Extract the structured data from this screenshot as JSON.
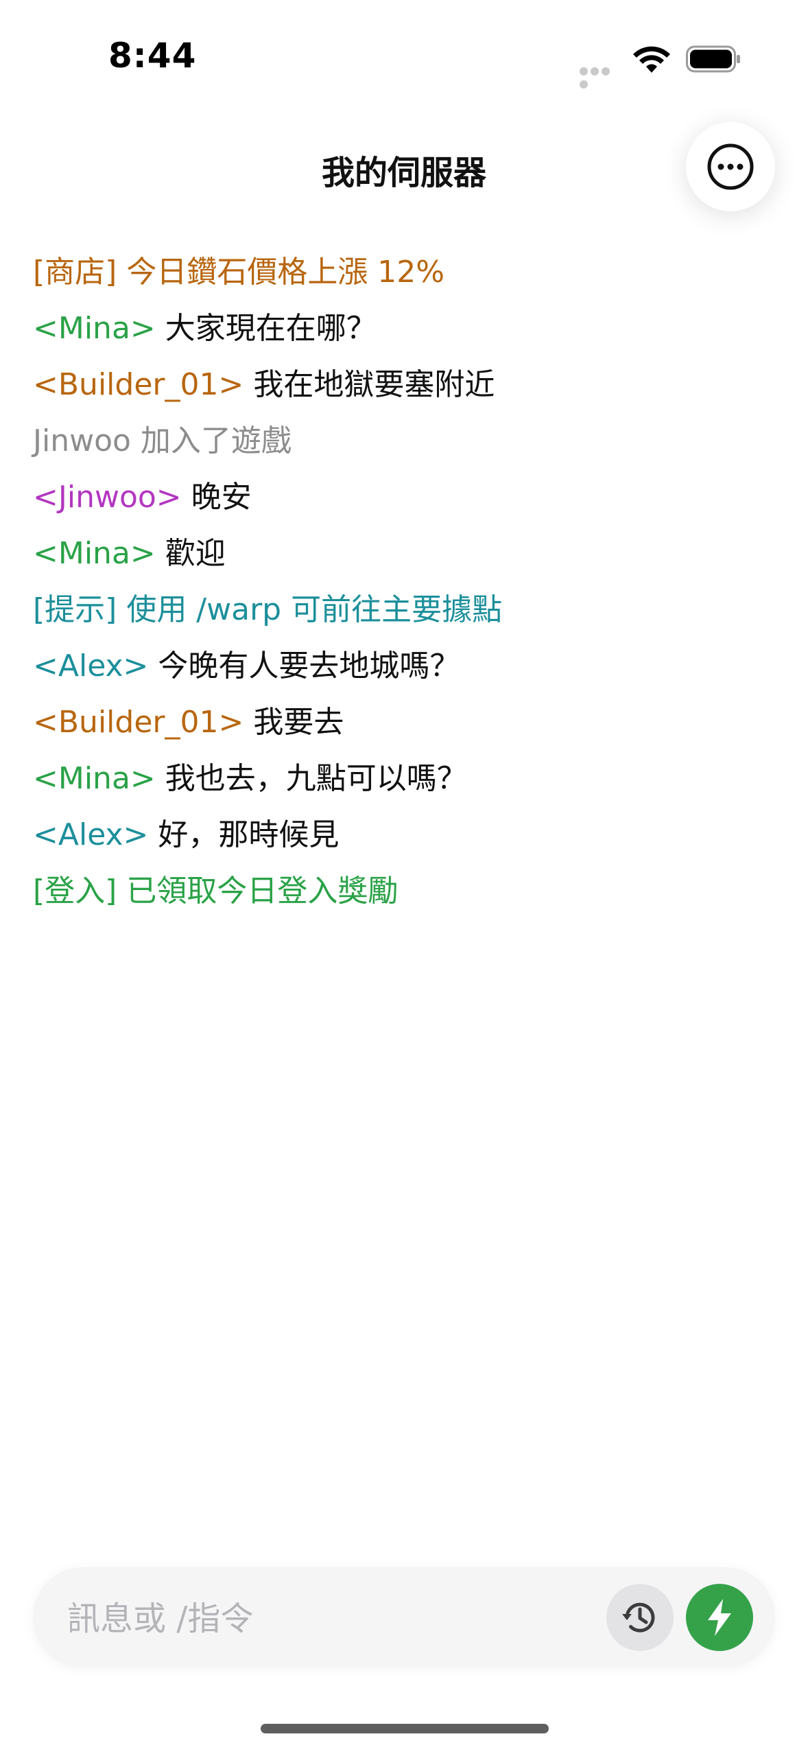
{
  "status_bar": {
    "time": "8:44"
  },
  "header": {
    "title": "我的伺服器",
    "more_icon": "ellipsis-circle-icon"
  },
  "colors": {
    "shop": "#b8660f",
    "green_name": "#2aa247",
    "orange_name": "#b8660f",
    "system_gray": "#8c8c8c",
    "magenta_name": "#b236c0",
    "teal": "#1c8f9b",
    "login_green": "#2aa247",
    "text": "#111111",
    "send_button": "#35a24a"
  },
  "chat": {
    "lines": [
      {
        "prefix": "[商店] 今日鑽石價格上漲 12%",
        "text": "",
        "color": "#b8660f"
      },
      {
        "prefix": "<Mina>",
        "text": " 大家現在在哪？",
        "color": "#2aa247"
      },
      {
        "prefix": "<Builder_01>",
        "text": " 我在地獄要塞附近",
        "color": "#b8660f"
      },
      {
        "prefix": "Jinwoo 加入了遊戲",
        "text": "",
        "color": "#8c8c8c"
      },
      {
        "prefix": "<Jinwoo>",
        "text": " 晚安",
        "color": "#b236c0"
      },
      {
        "prefix": "<Mina>",
        "text": " 歡迎",
        "color": "#2aa247"
      },
      {
        "prefix": "[提示] 使用 /warp 可前往主要據點",
        "text": "",
        "color": "#1c8f9b"
      },
      {
        "prefix": "<Alex>",
        "text": " 今晚有人要去地城嗎？",
        "color": "#1c8f9b"
      },
      {
        "prefix": "<Builder_01>",
        "text": " 我要去",
        "color": "#b8660f"
      },
      {
        "prefix": "<Mina>",
        "text": " 我也去，九點可以嗎？",
        "color": "#2aa247"
      },
      {
        "prefix": "<Alex>",
        "text": " 好，那時候見",
        "color": "#1c8f9b"
      },
      {
        "prefix": "[登入] 已領取今日登入獎勵",
        "text": "",
        "color": "#2aa247"
      }
    ]
  },
  "composer": {
    "placeholder": "訊息或 /指令",
    "value": "",
    "history_icon": "history-icon",
    "send_icon": "lightning-bolt-icon"
  }
}
